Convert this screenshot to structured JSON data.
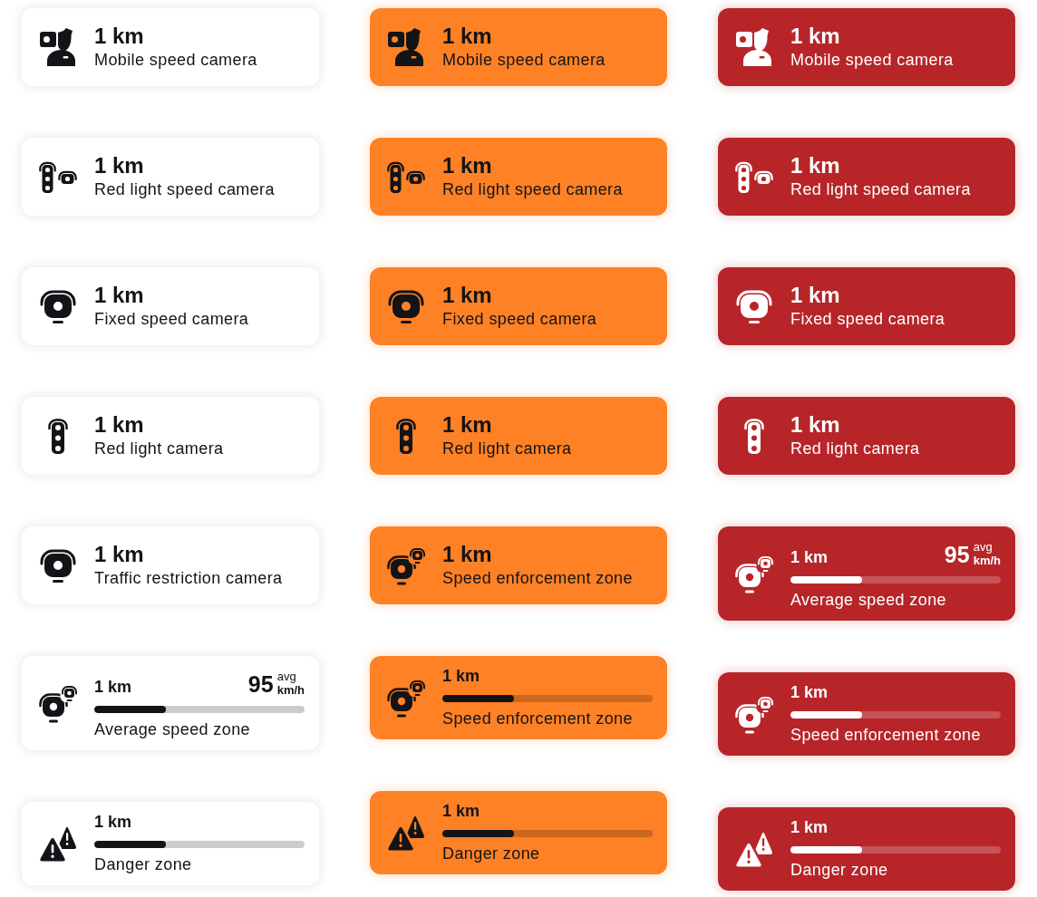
{
  "columns": [
    {
      "color": "#ffffff",
      "alerts": [
        {
          "kind": "mobile",
          "distance": "1 km",
          "label": "Mobile speed camera"
        },
        {
          "kind": "hybrid",
          "distance": "1 km",
          "label": "Red light speed camera"
        },
        {
          "kind": "fixed",
          "distance": "1 km",
          "label": "Fixed speed camera"
        },
        {
          "kind": "signal",
          "distance": "1 km",
          "label": "Red light camera"
        },
        {
          "kind": "fixed",
          "distance": "1 km",
          "label": "Traffic restriction camera"
        },
        {
          "kind": "zone",
          "distance": "1 km",
          "speed": "95",
          "speed_note": "avg",
          "speed_unit": "km/h",
          "level": 0.34,
          "label": "Average speed zone"
        },
        {
          "kind": "hazard",
          "distance": "1 km",
          "level": 0.34,
          "label": "Danger zone"
        }
      ]
    },
    {
      "color": "#ff8125",
      "alerts": [
        {
          "kind": "mobile",
          "distance": "1 km",
          "label": "Mobile speed camera"
        },
        {
          "kind": "hybrid",
          "distance": "1 km",
          "label": "Red light speed camera"
        },
        {
          "kind": "fixed",
          "distance": "1 km",
          "label": "Fixed speed camera"
        },
        {
          "kind": "signal",
          "distance": "1 km",
          "label": "Red light camera"
        },
        {
          "kind": "zone",
          "distance": "1 km",
          "label": "Speed enforcement zone"
        },
        {
          "kind": "zone",
          "distance": "1 km",
          "level": 0.34,
          "label": "Speed enforcement zone"
        },
        {
          "kind": "hazard",
          "distance": "1 km",
          "level": 0.34,
          "label": "Danger zone"
        }
      ]
    },
    {
      "color": "#b72529",
      "alerts": [
        {
          "kind": "mobile",
          "distance": "1 km",
          "label": "Mobile speed camera"
        },
        {
          "kind": "hybrid",
          "distance": "1 km",
          "label": "Red light speed camera"
        },
        {
          "kind": "fixed",
          "distance": "1 km",
          "label": "Fixed speed camera"
        },
        {
          "kind": "signal",
          "distance": "1 km",
          "label": "Red light camera"
        },
        {
          "kind": "zone",
          "distance": "1 km",
          "speed": "95",
          "speed_note": "avg",
          "speed_unit": "km/h",
          "level": 0.34,
          "label": "Average speed zone"
        },
        {
          "kind": "zone",
          "distance": "1 km",
          "level": 0.34,
          "label": "Speed enforcement zone"
        },
        {
          "kind": "hazard",
          "distance": "1 km",
          "level": 0.34,
          "label": "Danger zone"
        }
      ]
    }
  ]
}
